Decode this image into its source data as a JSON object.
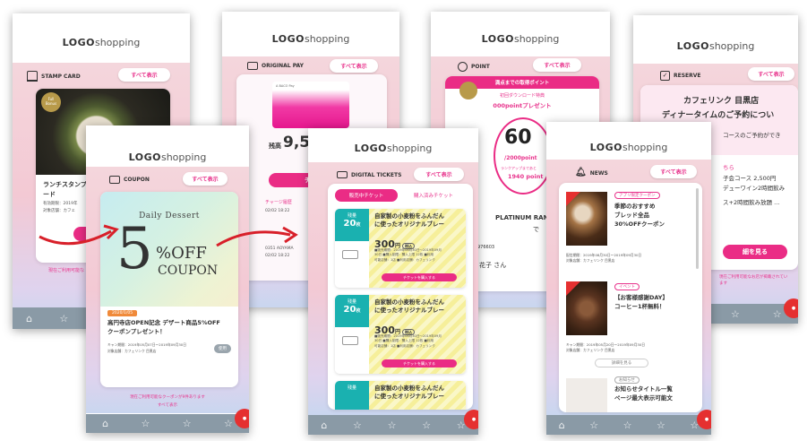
{
  "logo": {
    "bold": "LOGO",
    "rest": "shopping"
  },
  "see_all": "すべて表示",
  "stamp": {
    "title": "STAMP CARD",
    "badge": "Full\nBonus",
    "text": "ランチスタンプ\nード",
    "info1": "有効期限：2019年",
    "info2": "対象店舗：カフェ",
    "footer": "現在ご利用可能な"
  },
  "pay": {
    "title": "ORIGINAL PAY",
    "card_label": "A BACO Pay",
    "balance_label": "残高",
    "balance": "9,5",
    "button": "チャ",
    "charge_label": "チャージ履歴",
    "row1": "02/02 18:22",
    "row2": "0351 AOYAMA",
    "row3": "02/02 18:22"
  },
  "point": {
    "title": "POINT",
    "banner": "満点までの取得ポイント",
    "promo1": "初回ダウンロード特典",
    "promo2": "000pointプレゼント",
    "value": "60",
    "max": "/2000point",
    "rank_next": "ランクアップまであと",
    "rank_points": "1940 point",
    "rank": "PLATINUM RANK",
    "rank_sub": "で",
    "member_no": "976603",
    "name": "花子 さん"
  },
  "reserve": {
    "title": "RESERVE",
    "shop": "カフェリンク 目黒店",
    "headline": "ディナータイムのご予約につい",
    "line1": "コースのご予約ができ",
    "line2": "ちら",
    "line3": "子会コース 2,500円",
    "line4": "デューワイン2時間飲み",
    "line5": "ス+2時間飲み放題 …",
    "button": "細を見る",
    "footer": "現在ご利用可能なお店が掲載されています"
  },
  "coupon": {
    "title": "COUPON",
    "script": "Daily Dessert",
    "big": "5",
    "off": "%OFF",
    "word": "COUPON",
    "tag": "2020/1/05",
    "desc": "高円寺店OPEN記念 デザート商品5%OFF\nクーポンプレゼント！",
    "period": "キャン期間：2019年05月07日〜2019年09月30日",
    "shop": "対象店舗：カフェリンク 目黒店",
    "use": "使用",
    "footer1": "現在ご利用可能なクーポンが9件あります",
    "footer2": "すべて表示"
  },
  "tickets": {
    "title": "DIGITAL TICKETS",
    "tab_active": "販売中チケット",
    "tab_inactive": "購入済みチケット",
    "items": [
      {
        "label": "残量",
        "count": "20",
        "unit": "枚",
        "name": "自家製の小麦粉をふんだん\nに使ったオリジナルブレー",
        "price": "300",
        "yen": "円",
        "tax": "税込",
        "detail": "■販売期間：2019年06月30日〜2019年09月\n30日 ■購入制限：購入上限 12枚 ■利用\n可能店舗：1店 ■利用店舗：カフェリンク",
        "cta": "チケットを購入する"
      },
      {
        "label": "残量",
        "count": "20",
        "unit": "枚",
        "name": "自家製の小麦粉をふんだん\nに使ったオリジナルブレー",
        "price": "300",
        "yen": "円",
        "tax": "税込",
        "detail": "■販売期間：2019年06月30日〜2019年09月\n30日 ■購入制限：購入上限 12枚 ■利用\n可能店舗：1店 ■利用店舗：カフェリンク",
        "cta": "チケットを購入する"
      },
      {
        "label": "残量",
        "count": "20",
        "unit": "枚",
        "name": "自家製の小麦粉をふんだん\nに使ったオリジナルブレー"
      }
    ]
  },
  "news": {
    "title": "NEWS",
    "item1_tag": "アプリ限定クーポン",
    "item1_title": "季節のおすすめ\nブレッド全品\n30%OFFクーポン",
    "item1_info": "配信期間：2019年08月30日〜2019年09月30日\n対象店舗：カフェリンク 目黒店",
    "item2_tag": "イベント",
    "item2_title": "【お客様感謝DAY】\nコーヒー1杯無料！",
    "item2_info": "キャン期間：2019年05月20日〜2019年09月30日\n対象店舗：カフェリンク 目黒店",
    "item2_more": "詳細を見る",
    "item3_tag": "お知らせ",
    "item3_title": "お知らせタイトル一覧\nページ最大表示可能文"
  },
  "colors": {
    "accent": "#ea2c85",
    "teal": "#1ab1b0",
    "arrow": "#d8202a"
  }
}
